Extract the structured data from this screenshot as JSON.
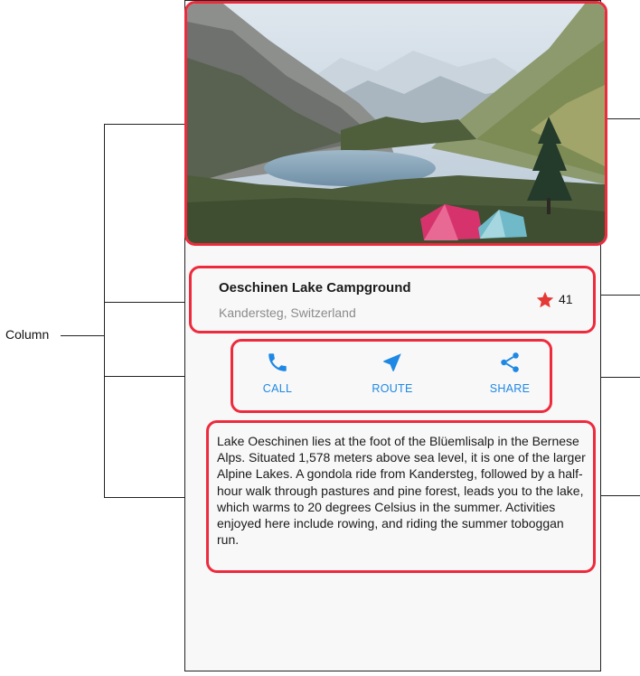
{
  "diagram": {
    "column_label": "Column"
  },
  "place": {
    "title": "Oeschinen Lake Campground",
    "location": "Kandersteg, Switzerland",
    "star_count": "41",
    "star_color": "#e53935"
  },
  "actions": [
    {
      "label": "CALL",
      "icon": "phone-icon"
    },
    {
      "label": "ROUTE",
      "icon": "navigation-icon"
    },
    {
      "label": "SHARE",
      "icon": "share-icon"
    }
  ],
  "description": "Lake Oeschinen lies at the foot of the Blüemlisalp in the Bernese Alps. Situated 1,578 meters above sea level, it is one of the larger Alpine Lakes. A gondola ride from Kandersteg, followed by a half-hour walk through pastures and pine forest, leads you to the lake, which warms to 20 degrees Celsius in the summer. Activities enjoyed here include rowing, and riding the summer toboggan run.",
  "colors": {
    "accent": "#1e88e5",
    "highlight": "#ee2a3d"
  }
}
